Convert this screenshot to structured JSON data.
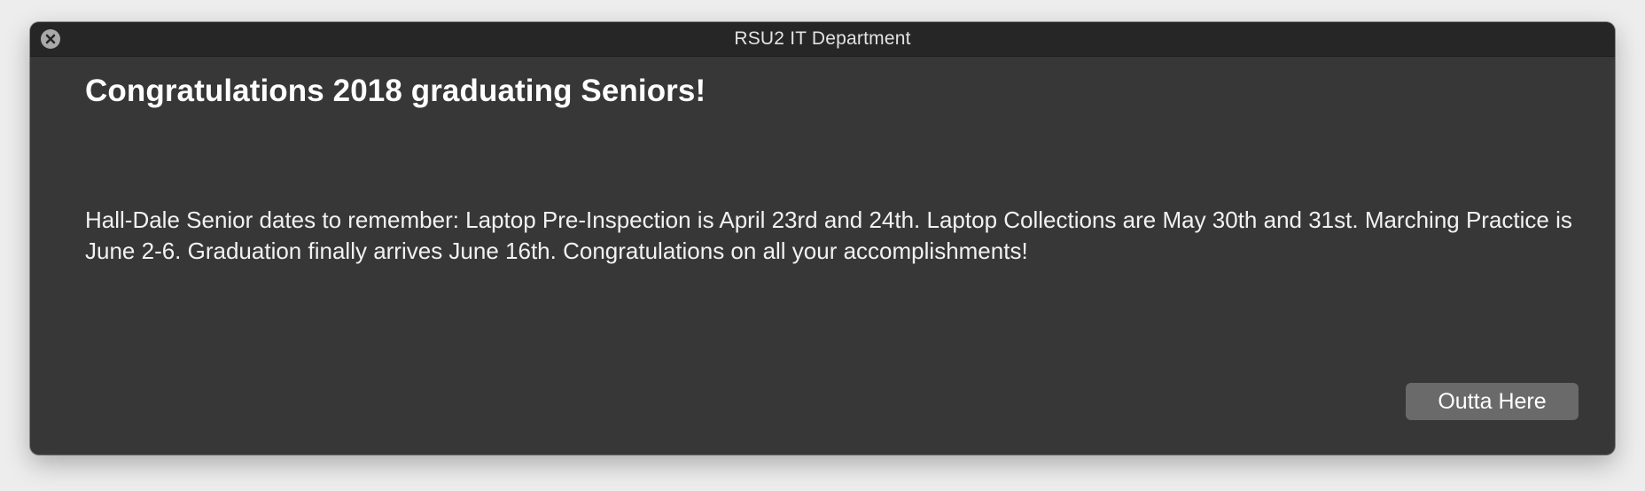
{
  "window": {
    "title": "RSU2 IT Department"
  },
  "dialog": {
    "heading": "Congratulations 2018 graduating Seniors!",
    "message": "Hall-Dale Senior dates to remember: Laptop Pre-Inspection is April 23rd and 24th. Laptop Collections are May 30th and 31st. Marching Practice is June 2-6. Graduation finally arrives June 16th. Congratulations on all your accomplishments!",
    "button_label": "Outta Here"
  },
  "icons": {
    "close": "close-icon"
  },
  "colors": {
    "window_background": "#373737",
    "titlebar_background": "#262626",
    "button_background": "#6a6a6a",
    "text": "#ffffff"
  }
}
